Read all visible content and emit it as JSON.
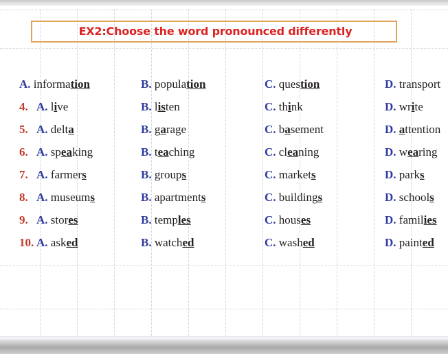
{
  "title": {
    "text": "EX2:Choose the word pronounced differently",
    "border_color": "#e0a458",
    "text_color": "#dd2222"
  },
  "colors": {
    "number": "#c0392b",
    "option_letter": "#2f3b9e",
    "word": "#231f20",
    "grid_dots": "#b9c0cc"
  },
  "rows": [
    {
      "number": "",
      "options": [
        {
          "letter": "A.",
          "pre": "informa",
          "underlined": "tion",
          "post": ""
        },
        {
          "letter": "B.",
          "pre": "popula",
          "underlined": "tion",
          "post": ""
        },
        {
          "letter": "C.",
          "pre": "ques",
          "underlined": "tion",
          "post": ""
        },
        {
          "letter": "D.",
          "pre": "transport",
          "underlined": "",
          "post": ""
        }
      ]
    },
    {
      "number": "4.",
      "options": [
        {
          "letter": "A.",
          "pre": "l",
          "underlined": "i",
          "post": "ve"
        },
        {
          "letter": "B.",
          "pre": "l",
          "underlined": "is",
          "post": "ten"
        },
        {
          "letter": "C.",
          "pre": "th",
          "underlined": "i",
          "post": "nk"
        },
        {
          "letter": "D.",
          "pre": "wr",
          "underlined": "i",
          "post": "te"
        }
      ]
    },
    {
      "number": "5.",
      "options": [
        {
          "letter": "A.",
          "pre": "delt",
          "underlined": "a",
          "post": ""
        },
        {
          "letter": "B.",
          "pre": "g",
          "underlined": "a",
          "post": "rage"
        },
        {
          "letter": "C.",
          "pre": "b",
          "underlined": "a",
          "post": "sement"
        },
        {
          "letter": "D.",
          "pre": "",
          "underlined": "a",
          "post": "ttention"
        }
      ]
    },
    {
      "number": "6.",
      "options": [
        {
          "letter": "A.",
          "pre": "sp",
          "underlined": "ea",
          "post": "king"
        },
        {
          "letter": "B.",
          "pre": "t",
          "underlined": "ea",
          "post": "ching"
        },
        {
          "letter": "C.",
          "pre": "cl",
          "underlined": "ea",
          "post": "ning"
        },
        {
          "letter": "D.",
          "pre": "w",
          "underlined": "ea",
          "post": "ring"
        }
      ]
    },
    {
      "number": "7.",
      "options": [
        {
          "letter": "A.",
          "pre": "farmer",
          "underlined": "s",
          "post": ""
        },
        {
          "letter": "B.",
          "pre": "group",
          "underlined": "s",
          "post": ""
        },
        {
          "letter": "C.",
          "pre": "market",
          "underlined": "s",
          "post": ""
        },
        {
          "letter": "D.",
          "pre": "park",
          "underlined": "s",
          "post": ""
        }
      ]
    },
    {
      "number": "8.",
      "options": [
        {
          "letter": "A.",
          "pre": "museum",
          "underlined": "s",
          "post": ""
        },
        {
          "letter": "B.",
          "pre": "apartment",
          "underlined": "s",
          "post": ""
        },
        {
          "letter": "C.",
          "pre": "building",
          "underlined": "s",
          "post": ""
        },
        {
          "letter": "D.",
          "pre": "school",
          "underlined": "s",
          "post": ""
        }
      ]
    },
    {
      "number": "9.",
      "options": [
        {
          "letter": "A.",
          "pre": "stor",
          "underlined": "es",
          "post": ""
        },
        {
          "letter": "B.",
          "pre": "temp",
          "underlined": "les",
          "post": ""
        },
        {
          "letter": "C.",
          "pre": "hous",
          "underlined": "es",
          "post": ""
        },
        {
          "letter": "D.",
          "pre": "famil",
          "underlined": "ies",
          "post": ""
        }
      ]
    },
    {
      "number": "10.",
      "options": [
        {
          "letter": "A.",
          "pre": "ask",
          "underlined": "ed",
          "post": ""
        },
        {
          "letter": "B.",
          "pre": "watch",
          "underlined": "ed",
          "post": ""
        },
        {
          "letter": "C.",
          "pre": "wash",
          "underlined": "ed",
          "post": ""
        },
        {
          "letter": "D.",
          "pre": "paint",
          "underlined": "ed",
          "post": ""
        }
      ]
    }
  ]
}
